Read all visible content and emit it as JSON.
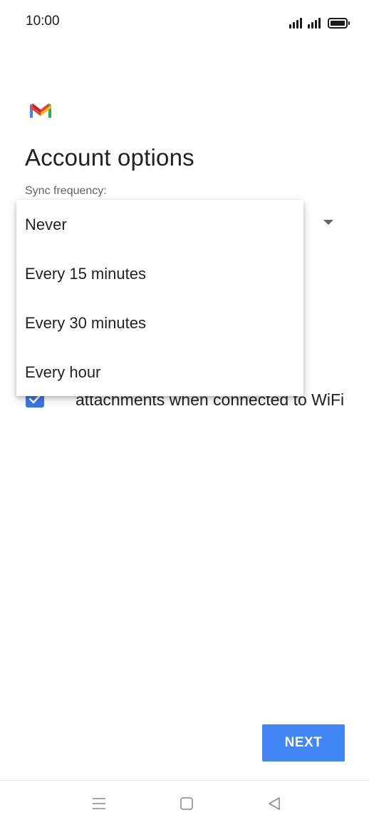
{
  "status_bar": {
    "time": "10:00",
    "icons": [
      "signal-1-icon",
      "signal-2-icon",
      "battery-icon"
    ],
    "battery_level": 1.0
  },
  "app": {
    "logo_icon": "gmail-logo-icon",
    "logo_colors": [
      "#4285F4",
      "#EA4335",
      "#FBBC04",
      "#34A853"
    ]
  },
  "page": {
    "title": "Account options",
    "sync_label": "Sync frequency:"
  },
  "sync_menu": {
    "options": [
      "Never",
      "Every 15 minutes",
      "Every 30 minutes",
      "Every hour"
    ]
  },
  "wifi_option": {
    "checked": true,
    "label_visible": "attachments when connected to WiFi"
  },
  "actions": {
    "next_label": "NEXT",
    "accent_color": "#4285F4"
  },
  "nav_bar": {
    "icons": [
      "menu-icon",
      "home-icon",
      "back-icon"
    ]
  }
}
